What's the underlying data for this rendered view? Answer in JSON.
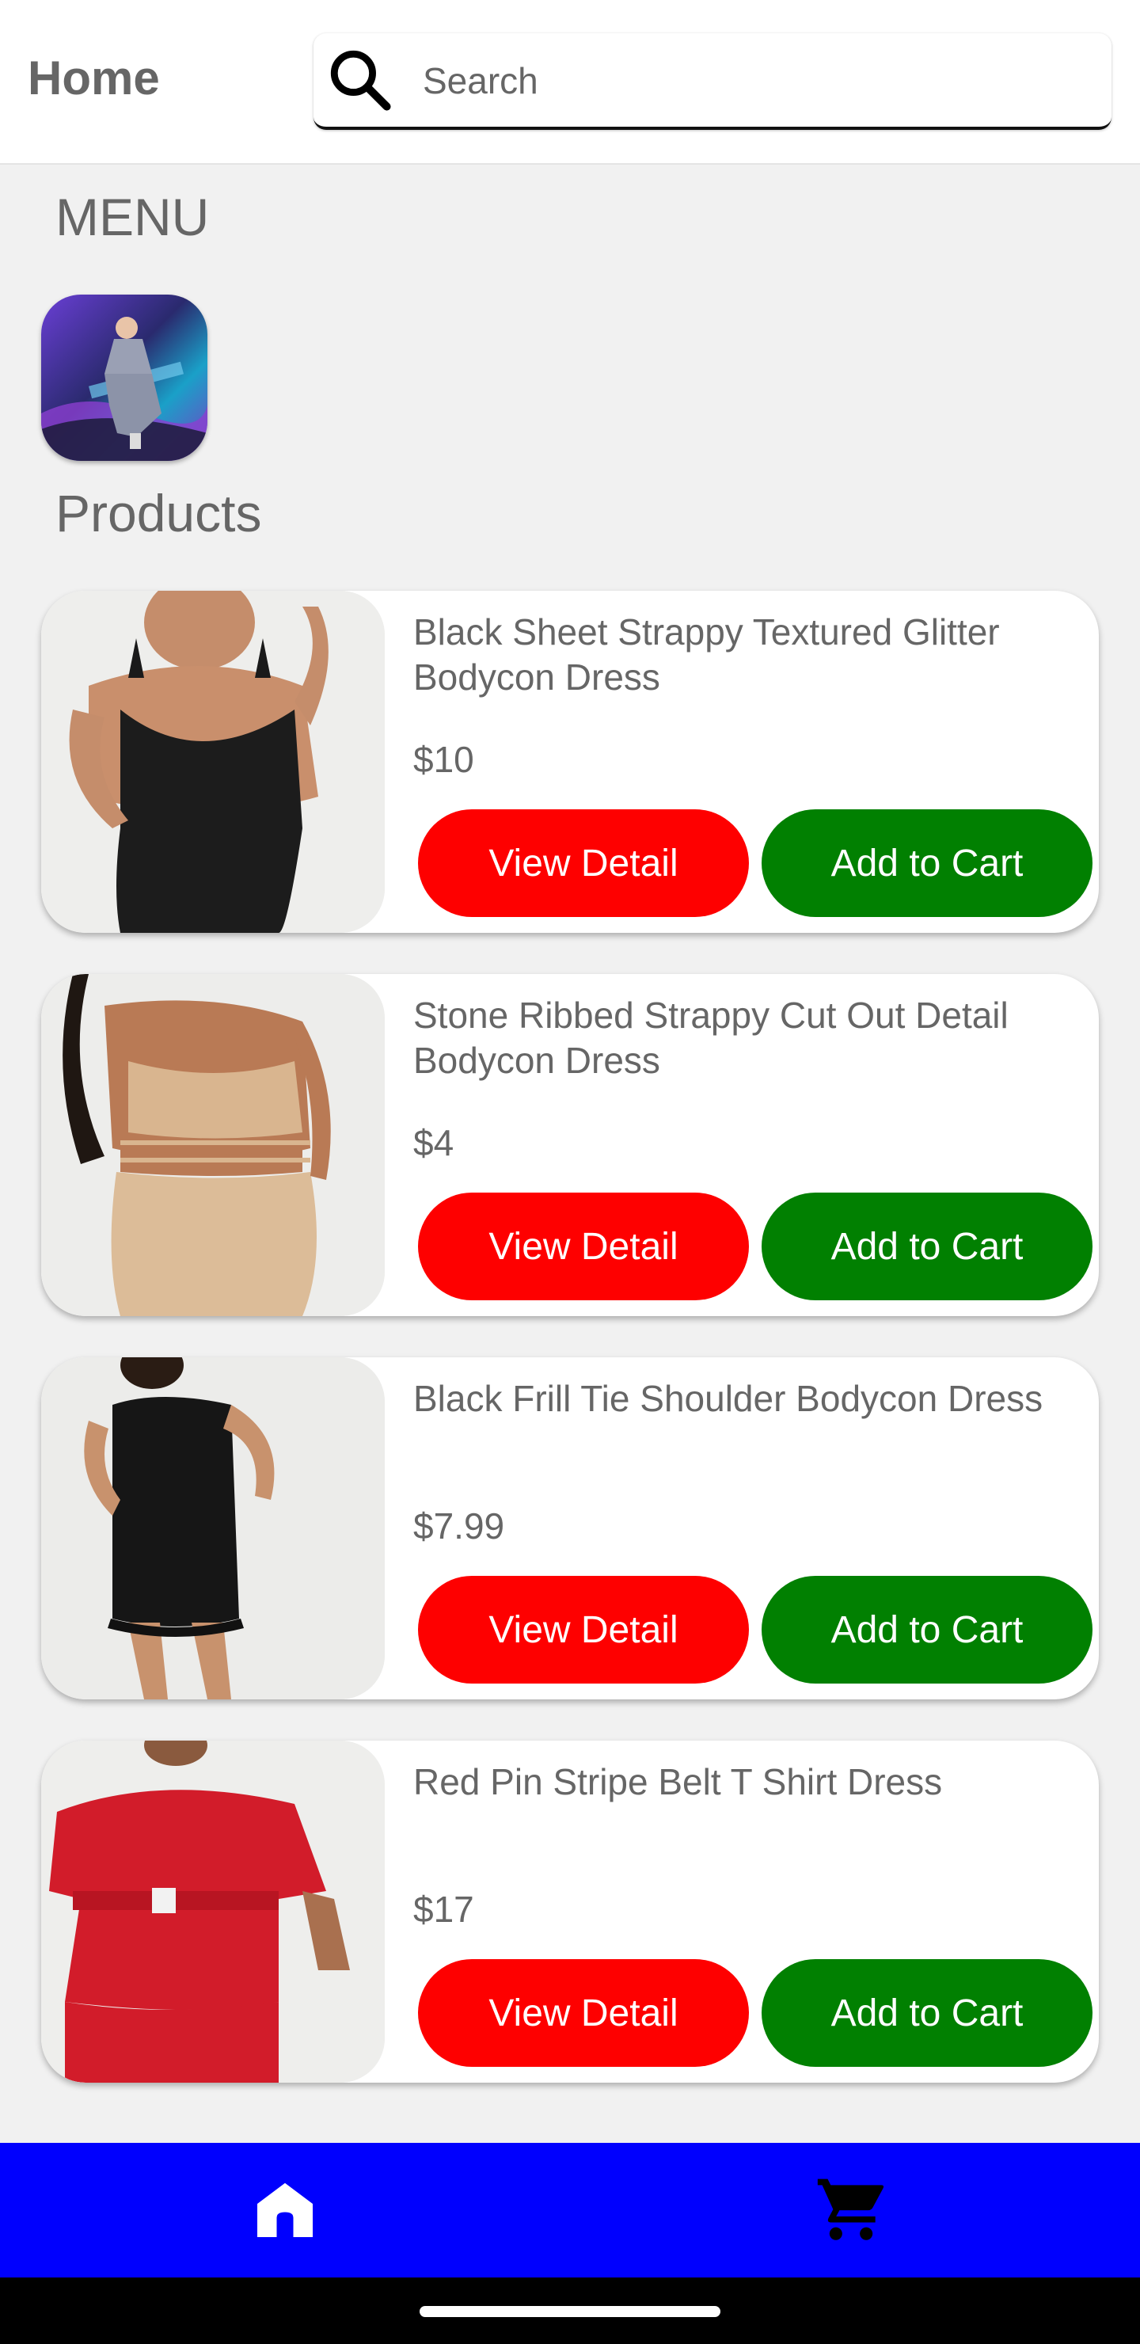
{
  "header": {
    "title": "Home",
    "search": {
      "placeholder": "Search",
      "value": ""
    }
  },
  "menu": {
    "title": "MENU"
  },
  "products_section": {
    "title": "Products",
    "items": [
      {
        "name": "Black Sheet Strappy Textured Glitter Bodycon Dress",
        "price": "$10",
        "view_label": "View Detail",
        "cart_label": "Add to Cart"
      },
      {
        "name": "Stone Ribbed Strappy Cut Out Detail Bodycon Dress",
        "price": "$4",
        "view_label": "View Detail",
        "cart_label": "Add to Cart"
      },
      {
        "name": "Black Frill Tie Shoulder Bodycon Dress",
        "price": "$7.99",
        "view_label": "View Detail",
        "cart_label": "Add to Cart"
      },
      {
        "name": "Red Pin Stripe Belt T Shirt Dress",
        "price": "$17",
        "view_label": "View Detail",
        "cart_label": "Add to Cart"
      }
    ]
  },
  "bottom_nav": {
    "items": [
      {
        "icon": "home-icon",
        "active": true
      },
      {
        "icon": "cart-icon",
        "active": false
      }
    ]
  },
  "colors": {
    "view_button": "#fe0000",
    "cart_button": "#018001",
    "bottom_nav": "#0000fe",
    "background": "#f1f1f1"
  }
}
